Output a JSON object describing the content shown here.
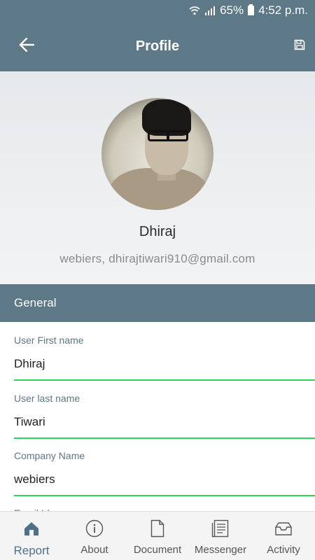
{
  "status_bar": {
    "battery_percent": "65%",
    "time": "4:52 p.m.",
    "icons": [
      "wifi-icon",
      "signal-icon",
      "battery-icon"
    ]
  },
  "app_bar": {
    "title": "Profile",
    "back_icon": "back-arrow-icon",
    "save_icon": "save-icon"
  },
  "profile": {
    "name": "Dhiraj",
    "subtitle": "webiers, dhirajtiwari910@gmail.com"
  },
  "section": {
    "title": "General"
  },
  "fields": [
    {
      "label": "User First name",
      "value": "Dhiraj"
    },
    {
      "label": "User last name",
      "value": "Tiwari"
    },
    {
      "label": "Company Name",
      "value": "webiers"
    },
    {
      "label": "Email Id",
      "value": ""
    }
  ],
  "bottom_nav": {
    "items": [
      {
        "label": "Report",
        "icon": "home-icon",
        "active": true
      },
      {
        "label": "About",
        "icon": "info-icon",
        "active": false
      },
      {
        "label": "Document",
        "icon": "document-icon",
        "active": false
      },
      {
        "label": "Messenger",
        "icon": "messenger-icon",
        "active": false
      },
      {
        "label": "Activity",
        "icon": "inbox-icon",
        "active": false
      }
    ]
  },
  "colors": {
    "primary": "#5d7886",
    "accent_underline": "#2bd65a",
    "active_nav": "#4e7189"
  }
}
